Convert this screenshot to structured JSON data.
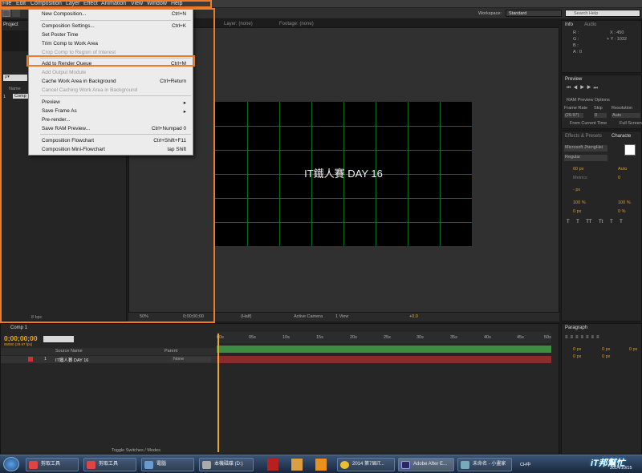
{
  "menubar": {
    "items": [
      "File",
      "Edit",
      "Composition",
      "Layer",
      "Effect",
      "Animation",
      "View",
      "Window",
      "Help"
    ],
    "workspace_label": "Workspace:",
    "workspace_value": "Standard",
    "search_placeholder": "Search Help"
  },
  "composition_menu": {
    "items": [
      {
        "label": "New Composition...",
        "shortcut": "Ctrl+N",
        "disabled": false
      },
      {
        "label": "Composition Settings...",
        "shortcut": "Ctrl+K",
        "disabled": false
      },
      {
        "label": "Set Poster Time",
        "shortcut": "",
        "disabled": false
      },
      {
        "label": "Trim Comp to Work Area",
        "shortcut": "",
        "disabled": false
      },
      {
        "label": "Crop Comp to Region of Interest",
        "shortcut": "",
        "disabled": true
      },
      {
        "label": "Add to Render Queue",
        "shortcut": "Ctrl+M",
        "disabled": false
      },
      {
        "label": "Add Output Module",
        "shortcut": "",
        "disabled": true
      },
      {
        "label": "Cache Work Area in Background",
        "shortcut": "Ctrl+Return",
        "disabled": false
      },
      {
        "label": "Cancel Caching Work Area in Background",
        "shortcut": "",
        "disabled": true
      },
      {
        "label": "Preview",
        "shortcut": "▸",
        "disabled": false
      },
      {
        "label": "Save Frame As",
        "shortcut": "▸",
        "disabled": false
      },
      {
        "label": "Pre-render...",
        "shortcut": "",
        "disabled": false
      },
      {
        "label": "Save RAM Preview...",
        "shortcut": "Ctrl+Numpad 0",
        "disabled": false
      },
      {
        "label": "Composition Flowchart",
        "shortcut": "Ctrl+Shift+F11",
        "disabled": false
      },
      {
        "label": "Composition Mini-Flowchart",
        "shortcut": "tap Shift",
        "disabled": false
      }
    ]
  },
  "project_panel": {
    "tab": "Project",
    "search_placeholder": "ρ▾",
    "col_name": "Name",
    "item_num": "1",
    "item_name": "Comp",
    "bpc": "8 bpc"
  },
  "viewer": {
    "tab_layer": "Layer: (none)",
    "tab_footage": "Footage: (none)",
    "comp_text": "IT鐵人賽 DAY 16",
    "zoom": "50%",
    "timecode": "0;00;00;00",
    "resolution": "(Half)",
    "camera": "Active Camera",
    "view": "1 View",
    "exposure": "+0.0"
  },
  "info_panel": {
    "tab_info": "Info",
    "tab_audio": "Audio",
    "r": "R :",
    "g": "G :",
    "b": "B :",
    "a": "A : 0",
    "x": "X : 450",
    "y": "+ Y : 1032"
  },
  "preview_panel": {
    "tab": "Preview",
    "ram_options": "RAM Preview Options",
    "frame_rate_label": "Frame Rate",
    "skip_label": "Skip",
    "resolution_label": "Resolution",
    "frame_rate": "(29.97)",
    "skip": "0",
    "resolution": "Auto",
    "from_current": "From Current Time",
    "full_screen": "Full Screen"
  },
  "character_panel": {
    "tab_effects": "Effects & Presets",
    "tab_character": "Characte",
    "font": "Microsoft JhengHei",
    "style": "Regular",
    "size": "60 px",
    "leading": "Auto",
    "kerning": "Metrics",
    "tracking": "0",
    "stroke": "- px",
    "vscale": "100 %",
    "hscale": "100 %",
    "baseline": "0 px",
    "tsume": "0 %",
    "styles": [
      "T",
      "T",
      "TT",
      "Tt",
      "T",
      "T"
    ]
  },
  "paragraph_panel": {
    "tab": "Paragraph",
    "indent1": "0 px",
    "indent2": "0 px",
    "indent3": "0 px",
    "space1": "0 px",
    "space2": "0 px"
  },
  "timeline": {
    "tab": "Comp 1",
    "timecode": "0;00;00;00",
    "timecode_sub": "00000 (29.97 fps)",
    "col_source": "Source Name",
    "col_parent": "Parent",
    "layer_num": "1",
    "layer_name": "IT鐵人賽 DAY 16",
    "layer_parent": "None",
    "ruler": [
      "00s",
      "05s",
      "10s",
      "15s",
      "20s",
      "25s",
      "30s",
      "35s",
      "40s",
      "45s",
      "50s"
    ],
    "toggle_label": "Toggle Switches / Modes"
  },
  "taskbar": {
    "items": [
      "剪取工具",
      "剪取工具",
      "電腦",
      "本機磁碟 (D:)",
      "2014 第7屆iT...",
      "Adobe After E...",
      "未命名 - 小畫家"
    ],
    "date": "2014/10/15",
    "watermark": "iT邦幫忙",
    "tray": "CH中"
  },
  "colors": {
    "highlight": "#ee7a2a",
    "grid": "#0c6e1b",
    "timeline_bar": "#3c8d41",
    "layer_bar": "#8b2b2b"
  }
}
